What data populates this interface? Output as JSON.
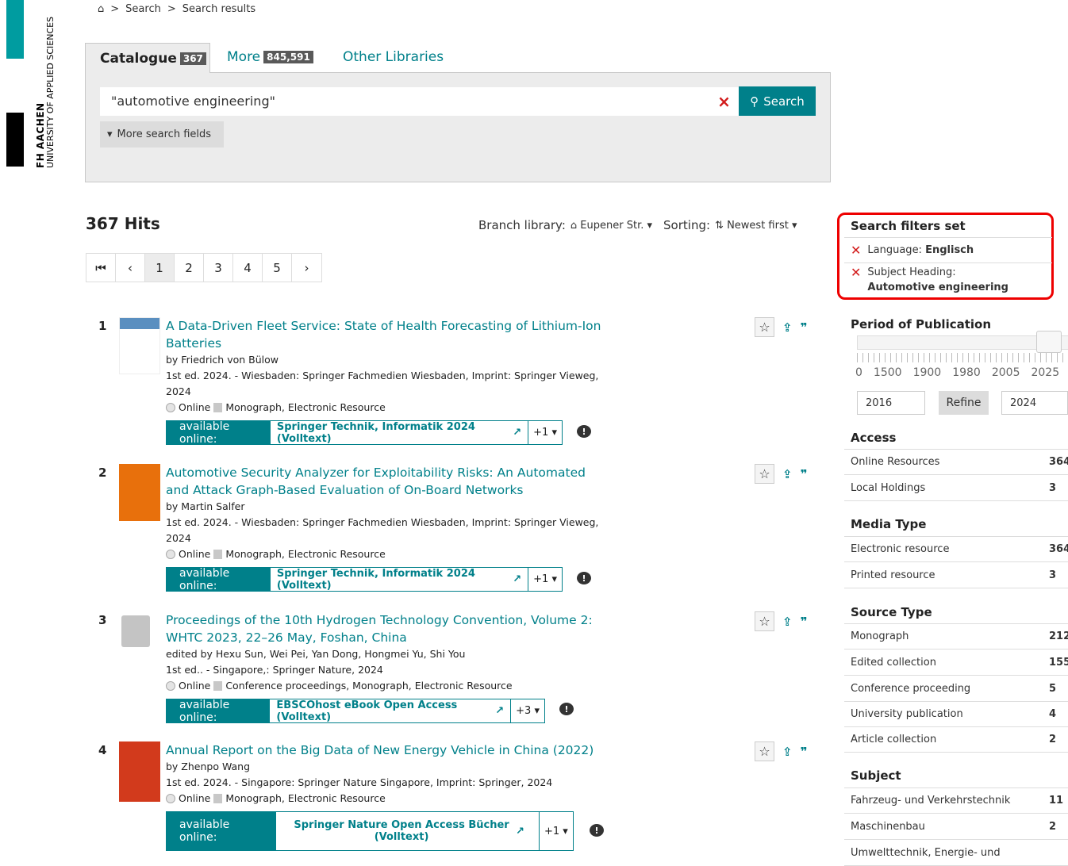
{
  "logo": {
    "line1": "FH AACHEN",
    "line2": "UNIVERSITY OF APPLIED SCIENCES"
  },
  "breadcrumb": {
    "home_icon": "home-icon",
    "items": [
      "Search",
      "Search results"
    ]
  },
  "tabs": [
    {
      "label": "Catalogue",
      "count": "367"
    },
    {
      "label": "More",
      "count": "845,591"
    },
    {
      "label": "Other Libraries"
    }
  ],
  "search": {
    "query": "\"automotive engineering\"",
    "button": "Search",
    "more_fields": "More search fields",
    "clear": "×"
  },
  "results_header": {
    "hits": "367 Hits",
    "branch_label": "Branch library:",
    "branch_value": "Eupener Str.",
    "sort_label": "Sorting:",
    "sort_value": "Newest first"
  },
  "pagination": [
    "1",
    "2",
    "3",
    "4",
    "5"
  ],
  "results": [
    {
      "num": "1",
      "title": "A Data-Driven Fleet Service: State of Health Forecasting of Lithium-Ion Batteries",
      "by": "by Friedrich von Bülow",
      "edition": "1st ed. 2024. - Wiesbaden: Springer Fachmedien Wiesbaden, Imprint: Springer Vieweg, 2024",
      "online": "Online",
      "format": "Monograph, Electronic Resource",
      "avail_label": "available online:",
      "source": "Springer Technik, Informatik 2024 (Volltext)",
      "more": "+1"
    },
    {
      "num": "2",
      "title": "Automotive Security Analyzer for Exploitability Risks: An Automated and Attack Graph-Based Evaluation of On-Board Networks",
      "by": "by Martin Salfer",
      "edition": "1st ed. 2024. - Wiesbaden: Springer Fachmedien Wiesbaden, Imprint: Springer Vieweg, 2024",
      "online": "Online",
      "format": "Monograph, Electronic Resource",
      "avail_label": "available online:",
      "source": "Springer Technik, Informatik 2024 (Volltext)",
      "more": "+1"
    },
    {
      "num": "3",
      "title": "Proceedings of the 10th Hydrogen Technology Convention, Volume 2: WHTC 2023, 22–26 May, Foshan, China",
      "by": "edited by Hexu Sun, Wei Pei, Yan Dong, Hongmei Yu, Shi You",
      "edition": "1st ed.. - Singapore,: Springer Nature, 2024",
      "online": "Online",
      "format": "Conference proceedings, Monograph, Electronic Resource",
      "avail_label": "available online:",
      "source": "EBSCOhost eBook Open Access (Volltext)",
      "more": "+3"
    },
    {
      "num": "4",
      "title": "Annual Report on the Big Data of New Energy Vehicle in China (2022)",
      "by": "by Zhenpo Wang",
      "edition": "1st ed. 2024. - Singapore: Springer Nature Singapore, Imprint: Springer, 2024",
      "online": "Online",
      "format": "Monograph, Electronic Resource",
      "avail_label": "available online:",
      "source": "Springer Nature Open Access Bücher (Volltext)",
      "more": "+1"
    }
  ],
  "sidebar": {
    "filters_title": "Search filters set",
    "filters": [
      {
        "key": "Language:",
        "value": "Englisch"
      },
      {
        "key": "Subject Heading:",
        "value": "Automotive engineering"
      }
    ],
    "period_title": "Period of Publication",
    "period_ticks": [
      "0",
      "1500",
      "1900",
      "1980",
      "2005",
      "2025"
    ],
    "period_from": "2016",
    "period_to": "2024",
    "refine": "Refine",
    "access_title": "Access",
    "access": [
      {
        "label": "Online Resources",
        "count": "364"
      },
      {
        "label": "Local Holdings",
        "count": "3"
      }
    ],
    "media_title": "Media Type",
    "media": [
      {
        "label": "Electronic resource",
        "count": "364"
      },
      {
        "label": "Printed resource",
        "count": "3"
      }
    ],
    "source_title": "Source Type",
    "source": [
      {
        "label": "Monograph",
        "count": "212"
      },
      {
        "label": "Edited collection",
        "count": "155"
      },
      {
        "label": "Conference proceeding",
        "count": "5"
      },
      {
        "label": "University publication",
        "count": "4"
      },
      {
        "label": "Article collection",
        "count": "2"
      }
    ],
    "subject_title": "Subject",
    "subject": [
      {
        "label": "Fahrzeug- und Verkehrstechnik",
        "count": "11"
      },
      {
        "label": "Maschinenbau",
        "count": "2"
      },
      {
        "label": "Umwelttechnik, Energie- und",
        "count": ""
      }
    ]
  }
}
